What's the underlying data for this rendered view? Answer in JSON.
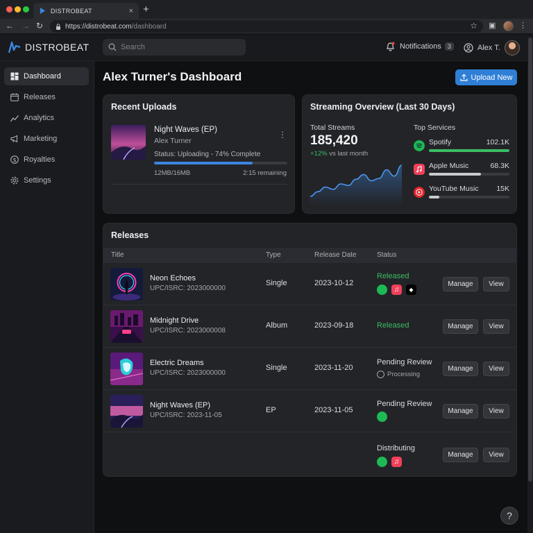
{
  "browser": {
    "tab_title": "DISTROBEAT",
    "tab_close": "×",
    "new_tab": "+",
    "url_host": "https://distrobeat.com",
    "url_path": "/dashboard"
  },
  "header": {
    "logo": "DISTROBEAT",
    "search_placeholder": "Search",
    "notifications_label": "Notifications",
    "notifications_count": "3",
    "user_name": "Alex T."
  },
  "sidebar": {
    "items": [
      {
        "label": "Dashboard",
        "icon": "dashboard-icon",
        "active": true
      },
      {
        "label": "Releases",
        "icon": "calendar-icon"
      },
      {
        "label": "Analytics",
        "icon": "analytics-icon"
      },
      {
        "label": "Marketing",
        "icon": "megaphone-icon"
      },
      {
        "label": "Royalties",
        "icon": "dollar-icon"
      },
      {
        "label": "Settings",
        "icon": "gear-icon"
      }
    ]
  },
  "main": {
    "title": "Alex Turner's Dashboard",
    "upload_button": "Upload New"
  },
  "recent_uploads": {
    "title": "Recent Uploads",
    "item": {
      "name": "Night Waves (EP)",
      "artist": "Alex Turner",
      "status": "Status: Uploading - 74% Complete",
      "progress": 0.74,
      "size": "12MB/16MB",
      "remaining": "2:15 remaining"
    }
  },
  "streaming": {
    "title": "Streaming Overview (Last 30 Days)",
    "total_label": "Total Streams",
    "total": "185,420",
    "change": "+12%",
    "change_suffix": "vs last month",
    "top_label": "Top Services",
    "trend": [
      8,
      14,
      20,
      17,
      24,
      22,
      30,
      36,
      28,
      31,
      42,
      34,
      48
    ],
    "services": [
      {
        "name": "Spotify",
        "value": "102.1K",
        "share": 1.0,
        "color": "#3bbd63",
        "icon": "spotify-icon"
      },
      {
        "name": "Apple Music",
        "value": "68.3K",
        "share": 0.65,
        "color": "#c9cacd",
        "icon": "apple-music-icon"
      },
      {
        "name": "YouTube Music",
        "value": "15K",
        "share": 0.13,
        "color": "#c9cacd",
        "icon": "youtube-music-icon"
      }
    ]
  },
  "releases": {
    "title": "Releases",
    "columns": [
      "Title",
      "Type",
      "Release Date",
      "Status"
    ],
    "manage_label": "Manage",
    "view_label": "View",
    "processing_label": "Processing",
    "rows": [
      {
        "name": "Neon Echoes",
        "code": "UPC/ISRC: 2023000000",
        "type": "Single",
        "date": "2023-10-12",
        "status": "Released",
        "status_color": "green"
      },
      {
        "name": "Midnight Drive",
        "code": "UPC/ISRC: 2023000008",
        "type": "Album",
        "date": "2023-09-18",
        "status": "Released",
        "status_color": "green"
      },
      {
        "name": "Electric Dreams",
        "code": "UPC/ISRC: 2023000000",
        "type": "Single",
        "date": "2023-11-20",
        "status": "Pending Review",
        "status_color": "white"
      },
      {
        "name": "Night Waves (EP)",
        "code": "UPC/ISRC: 2023-11-05",
        "type": "EP",
        "date": "2023-11-05",
        "status": "Pending Review",
        "status_color": "white"
      },
      {
        "name": "",
        "code": "",
        "type": "",
        "date": "",
        "status": "Distributing",
        "status_color": "white"
      }
    ]
  },
  "help_label": "?"
}
